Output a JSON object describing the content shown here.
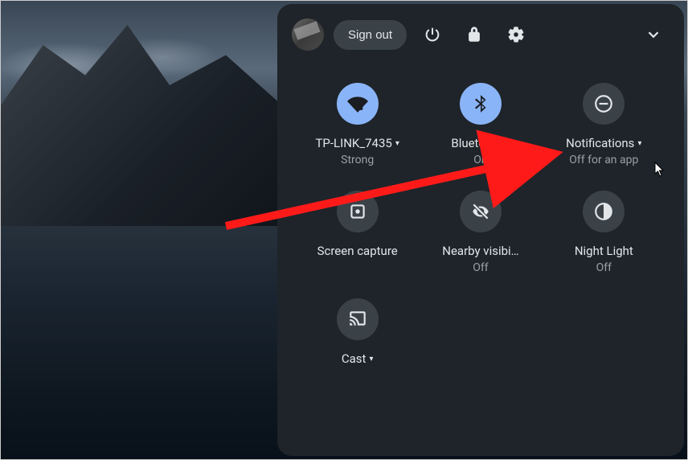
{
  "header": {
    "signout_label": "Sign out"
  },
  "tiles": [
    {
      "title": "TP-LINK_7435",
      "subtitle": "Strong",
      "has_caret": true,
      "active": true
    },
    {
      "title": "Bluetooth",
      "subtitle": "On",
      "has_caret": true,
      "active": true
    },
    {
      "title": "Notifications",
      "subtitle": "Off for an app",
      "has_caret": true,
      "active": false
    },
    {
      "title": "Screen capture",
      "subtitle": "",
      "has_caret": false,
      "active": false
    },
    {
      "title": "Nearby visibi…",
      "subtitle": "Off",
      "has_caret": false,
      "active": false
    },
    {
      "title": "Night Light",
      "subtitle": "Off",
      "has_caret": false,
      "active": false
    },
    {
      "title": "Cast",
      "subtitle": "",
      "has_caret": true,
      "active": false
    }
  ]
}
